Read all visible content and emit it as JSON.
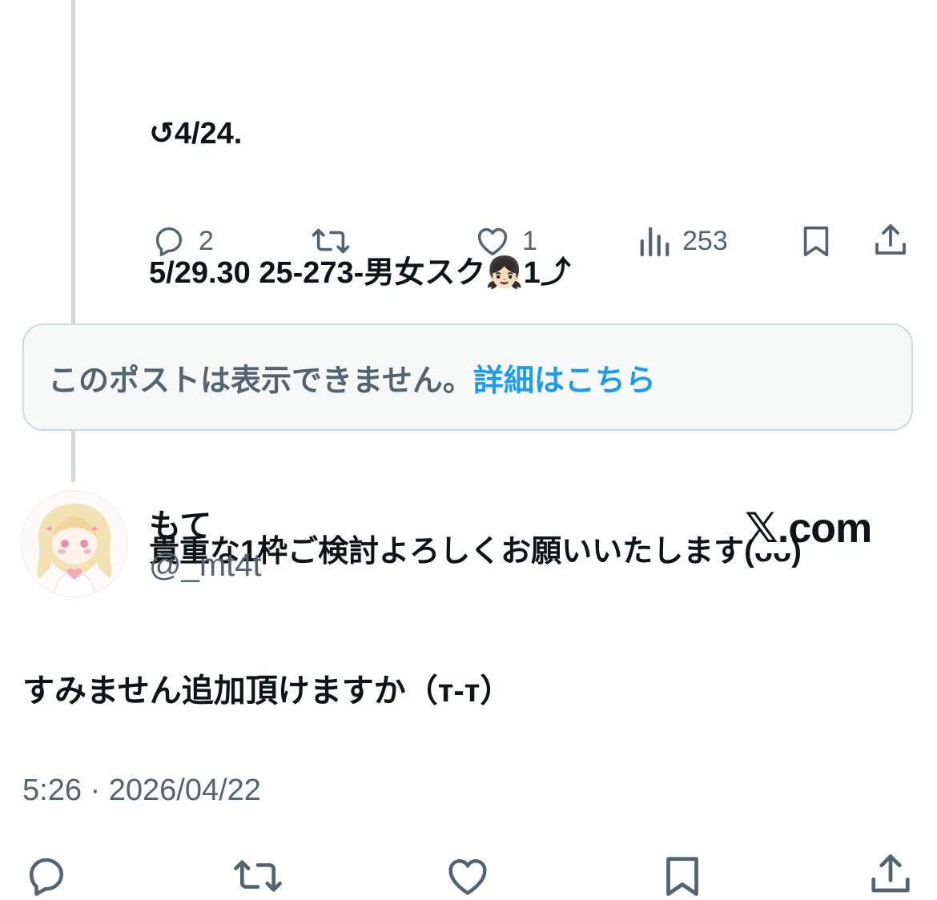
{
  "post": {
    "lines": [
      "↺4/24.",
      "5/29.30 25-273-男女スク👧🏻1⤴",
      "",
      "貴重な1枠ご検討よろしくお願いいたします(ᴗᴗ)"
    ],
    "metrics": {
      "replies": "2",
      "reposts": "",
      "likes": "1",
      "views": "253"
    }
  },
  "notice": {
    "message": "このポストは表示できません。",
    "link": "詳細はこちら"
  },
  "reply": {
    "display_name": "もて",
    "handle": "@_mt4t",
    "brand": "𝕏.com",
    "text": "すみません追加頂けますか（т-т）",
    "timestamp": "5:26 · 2026/04/22"
  },
  "colors": {
    "text": "#0f1419",
    "secondary": "#536471",
    "link": "#1d9bf0",
    "border": "#cfd9de",
    "notice_bg": "#f7f9f9"
  },
  "icons": [
    "reply-icon",
    "repost-icon",
    "like-icon",
    "views-icon",
    "bookmark-icon",
    "share-icon"
  ]
}
